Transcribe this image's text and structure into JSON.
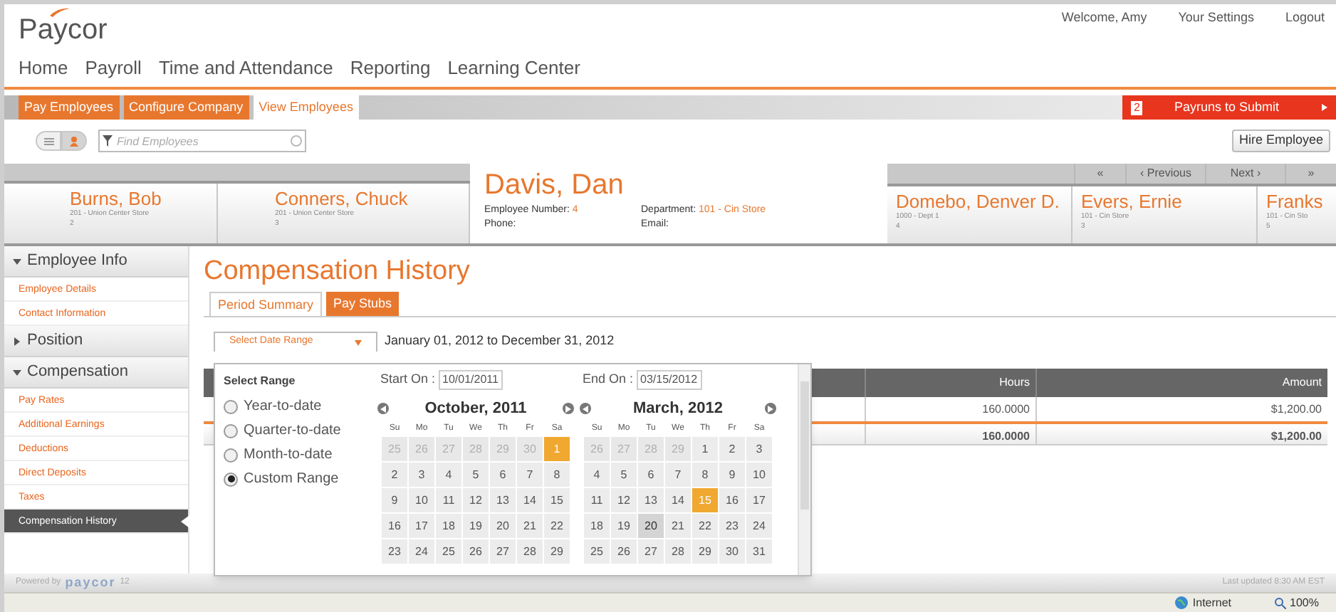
{
  "header": {
    "logo": "Paycor",
    "links": [
      "Welcome, Amy",
      "Your Settings",
      "Logout"
    ]
  },
  "nav": [
    "Home",
    "Payroll",
    "Time and Attendance",
    "Reporting",
    "Learning Center"
  ],
  "tabs": [
    {
      "label": "Pay Employees",
      "selected": false
    },
    {
      "label": "Configure Company",
      "selected": false
    },
    {
      "label": "View Employees",
      "selected": true
    }
  ],
  "payruns": {
    "count": "2",
    "label": "Payruns to Submit"
  },
  "view_toggle": [
    {
      "kind": "list",
      "selected": false
    },
    {
      "kind": "person",
      "selected": true
    }
  ],
  "search": {
    "placeholder": "Find Employees"
  },
  "hire_button": "Hire Employee",
  "pager": [
    "«",
    "‹ Previous",
    "Next ›",
    "»"
  ],
  "employees_before": [
    {
      "name": "Burns, Bob",
      "dept": "201 - Union Center Store",
      "number": "2"
    },
    {
      "name": "Conners, Chuck",
      "dept": "201 - Union Center Store",
      "number": "3"
    }
  ],
  "current_employee": {
    "name": "Davis, Dan",
    "fields": [
      {
        "label": "Employee Number:",
        "value": "4"
      },
      {
        "label": "Department:",
        "value": "101 - Cin Store"
      },
      {
        "label": "Phone:"
      },
      {
        "label": "Email:"
      }
    ]
  },
  "employees_after": [
    {
      "name": "Domebo, Denver D.",
      "dept": "1000 - Dept 1",
      "number": "4"
    },
    {
      "name": "Evers, Ernie",
      "dept": "101 - Cin Store",
      "number": "3"
    },
    {
      "name": "Franks",
      "dept": "101 - Cin Sto",
      "number": "5"
    }
  ],
  "sidebar": [
    {
      "label": "Employee Info",
      "expanded": true,
      "children": [
        {
          "label": "Employee Details",
          "selected": false
        },
        {
          "label": "Contact Information",
          "selected": false
        }
      ]
    },
    {
      "label": "Position",
      "expanded": false
    },
    {
      "label": "Compensation",
      "expanded": true,
      "children": [
        {
          "label": "Pay Rates",
          "selected": false
        },
        {
          "label": "Additional Earnings",
          "selected": false
        },
        {
          "label": "Deductions",
          "selected": false
        },
        {
          "label": "Direct Deposits",
          "selected": false
        },
        {
          "label": "Taxes",
          "selected": false
        },
        {
          "label": "Compensation History",
          "selected": true
        }
      ]
    }
  ],
  "footer": {
    "powered_by": "Powered by",
    "brand": "paycor",
    "version": "12",
    "last_updated": "Last updated 8:30 AM EST"
  },
  "title": "Compensation History",
  "subtabs": [
    {
      "label": "Period Summary",
      "selected": true
    },
    {
      "label": "Pay Stubs",
      "selected": false
    }
  ],
  "range_dropdown": "Select Date Range",
  "range_text": "January 01, 2012 to December 31, 2012",
  "range_popup": {
    "heading": "Select Range",
    "options": [
      {
        "label": "Year-to-date",
        "selected": false
      },
      {
        "label": "Quarter-to-date",
        "selected": false
      },
      {
        "label": "Month-to-date",
        "selected": false
      },
      {
        "label": "Custom Range",
        "selected": true
      }
    ],
    "start": {
      "label": "Start On :",
      "value": "10/01/2011"
    },
    "end": {
      "label": "End On :",
      "value": "03/15/2012"
    },
    "months": [
      {
        "title": "October, 2011",
        "weekdays": [
          "Su",
          "Mo",
          "Tu",
          "We",
          "Th",
          "Fr",
          "Sa"
        ],
        "weeks": [
          [
            {
              "d": "25",
              "kind": "other"
            },
            {
              "d": "26",
              "kind": "other"
            },
            {
              "d": "27",
              "kind": "other"
            },
            {
              "d": "28",
              "kind": "other"
            },
            {
              "d": "29",
              "kind": "other"
            },
            {
              "d": "30",
              "kind": "other"
            },
            {
              "d": "1",
              "kind": "selected"
            }
          ],
          [
            {
              "d": "2",
              "kind": "normal"
            },
            {
              "d": "3",
              "kind": "normal"
            },
            {
              "d": "4",
              "kind": "normal"
            },
            {
              "d": "5",
              "kind": "normal"
            },
            {
              "d": "6",
              "kind": "normal"
            },
            {
              "d": "7",
              "kind": "normal"
            },
            {
              "d": "8",
              "kind": "normal"
            }
          ],
          [
            {
              "d": "9",
              "kind": "normal"
            },
            {
              "d": "10",
              "kind": "normal"
            },
            {
              "d": "11",
              "kind": "normal"
            },
            {
              "d": "12",
              "kind": "normal"
            },
            {
              "d": "13",
              "kind": "normal"
            },
            {
              "d": "14",
              "kind": "normal"
            },
            {
              "d": "15",
              "kind": "normal"
            }
          ],
          [
            {
              "d": "16",
              "kind": "normal"
            },
            {
              "d": "17",
              "kind": "normal"
            },
            {
              "d": "18",
              "kind": "normal"
            },
            {
              "d": "19",
              "kind": "normal"
            },
            {
              "d": "20",
              "kind": "normal"
            },
            {
              "d": "21",
              "kind": "normal"
            },
            {
              "d": "22",
              "kind": "normal"
            }
          ],
          [
            {
              "d": "23",
              "kind": "normal"
            },
            {
              "d": "24",
              "kind": "normal"
            },
            {
              "d": "25",
              "kind": "normal"
            },
            {
              "d": "26",
              "kind": "normal"
            },
            {
              "d": "27",
              "kind": "normal"
            },
            {
              "d": "28",
              "kind": "normal"
            },
            {
              "d": "29",
              "kind": "normal"
            }
          ]
        ]
      },
      {
        "title": "March, 2012",
        "weekdays": [
          "Su",
          "Mo",
          "Tu",
          "We",
          "Th",
          "Fr",
          "Sa"
        ],
        "weeks": [
          [
            {
              "d": "26",
              "kind": "other"
            },
            {
              "d": "27",
              "kind": "other"
            },
            {
              "d": "28",
              "kind": "other"
            },
            {
              "d": "29",
              "kind": "other"
            },
            {
              "d": "1",
              "kind": "normal"
            },
            {
              "d": "2",
              "kind": "normal"
            },
            {
              "d": "3",
              "kind": "normal"
            }
          ],
          [
            {
              "d": "4",
              "kind": "normal"
            },
            {
              "d": "5",
              "kind": "normal"
            },
            {
              "d": "6",
              "kind": "normal"
            },
            {
              "d": "7",
              "kind": "normal"
            },
            {
              "d": "8",
              "kind": "normal"
            },
            {
              "d": "9",
              "kind": "normal"
            },
            {
              "d": "10",
              "kind": "normal"
            }
          ],
          [
            {
              "d": "11",
              "kind": "normal"
            },
            {
              "d": "12",
              "kind": "normal"
            },
            {
              "d": "13",
              "kind": "normal"
            },
            {
              "d": "14",
              "kind": "normal"
            },
            {
              "d": "15",
              "kind": "selected"
            },
            {
              "d": "16",
              "kind": "normal"
            },
            {
              "d": "17",
              "kind": "normal"
            }
          ],
          [
            {
              "d": "18",
              "kind": "normal"
            },
            {
              "d": "19",
              "kind": "normal"
            },
            {
              "d": "20",
              "kind": "today"
            },
            {
              "d": "21",
              "kind": "normal"
            },
            {
              "d": "22",
              "kind": "normal"
            },
            {
              "d": "23",
              "kind": "normal"
            },
            {
              "d": "24",
              "kind": "normal"
            }
          ],
          [
            {
              "d": "25",
              "kind": "normal"
            },
            {
              "d": "26",
              "kind": "normal"
            },
            {
              "d": "27",
              "kind": "normal"
            },
            {
              "d": "28",
              "kind": "normal"
            },
            {
              "d": "29",
              "kind": "normal"
            },
            {
              "d": "30",
              "kind": "normal"
            },
            {
              "d": "31",
              "kind": "normal"
            }
          ]
        ]
      }
    ]
  },
  "table": {
    "columns": [
      "Hours",
      "Amount"
    ],
    "rows": [
      {
        "kind": "data",
        "cells": [
          "160.0000",
          "$1,200.00"
        ]
      },
      {
        "kind": "total",
        "cells": [
          "160.0000",
          "$1,200.00"
        ]
      }
    ]
  },
  "status_bar": {
    "zone": "Internet",
    "zoom": "100%"
  }
}
